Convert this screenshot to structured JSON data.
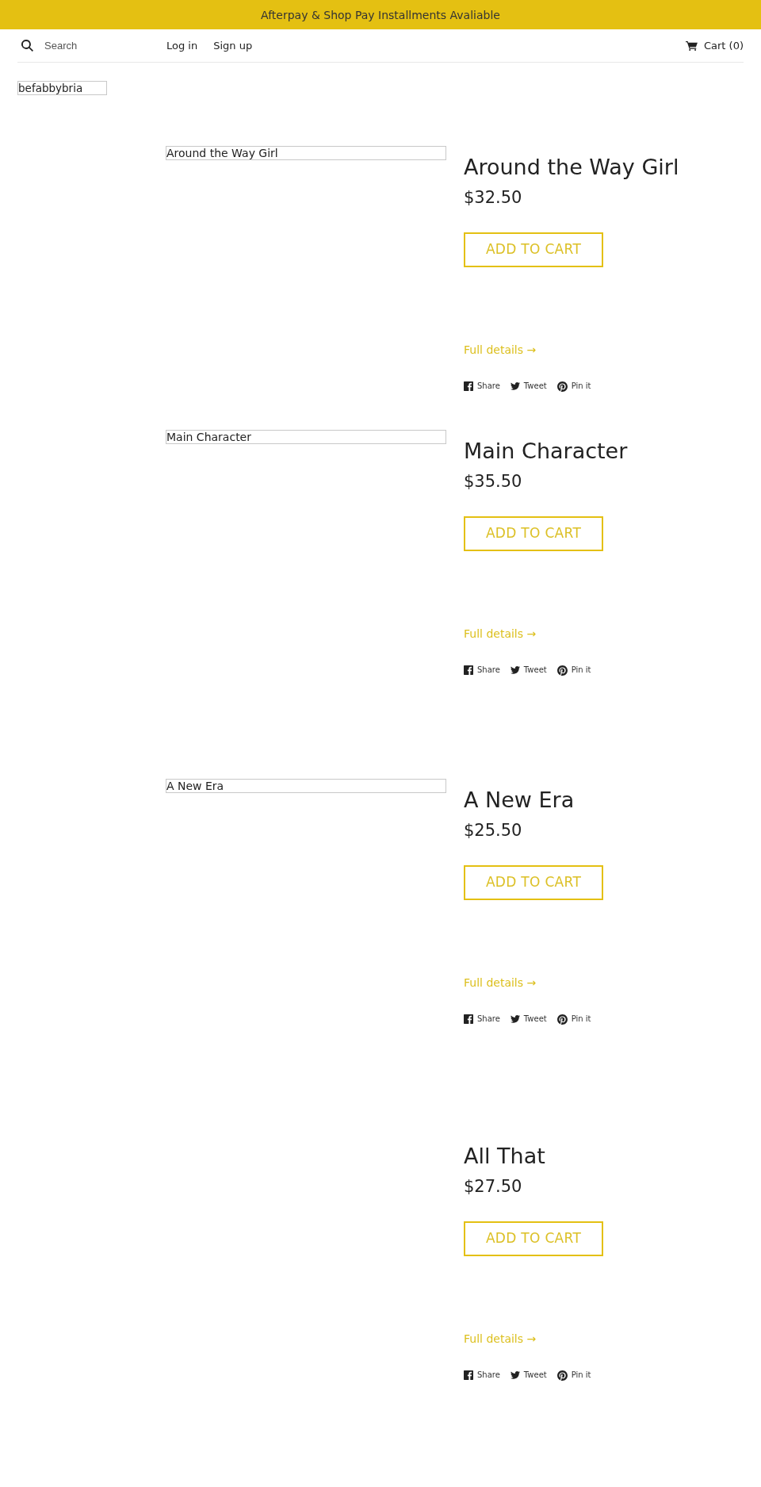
{
  "announcement": {
    "text": "Afterpay & Shop Pay Installments Avaliable"
  },
  "header": {
    "search": {
      "placeholder": "Search"
    },
    "account_links": [
      "Log in",
      "Sign up"
    ],
    "cart": {
      "label": "Cart (0)"
    }
  },
  "logo": {
    "alt_text": "befabbybria"
  },
  "products": [
    {
      "image_alt": "Around the Way Girl",
      "title": "Around the Way Girl",
      "price": "$32.50",
      "button": "ADD TO CART",
      "details_link": "Full details →",
      "share": [
        {
          "kind": "facebook",
          "label": "Share"
        },
        {
          "kind": "twitter",
          "label": "Tweet"
        },
        {
          "kind": "pinterest",
          "label": "Pin it"
        }
      ]
    },
    {
      "image_alt": "Main Character",
      "title": "Main Character",
      "price": "$35.50",
      "button": "ADD TO CART",
      "details_link": "Full details →",
      "share": [
        {
          "kind": "facebook",
          "label": "Share"
        },
        {
          "kind": "twitter",
          "label": "Tweet"
        },
        {
          "kind": "pinterest",
          "label": "Pin it"
        }
      ]
    },
    {
      "image_alt": "A New Era",
      "title": "A New Era",
      "price": "$25.50",
      "button": "ADD TO CART",
      "details_link": "Full details →",
      "share": [
        {
          "kind": "facebook",
          "label": "Share"
        },
        {
          "kind": "twitter",
          "label": "Tweet"
        },
        {
          "kind": "pinterest",
          "label": "Pin it"
        }
      ]
    },
    {
      "title": "All That",
      "price": "$27.50",
      "button": "ADD TO CART",
      "details_link": "Full details →",
      "share": [
        {
          "kind": "facebook",
          "label": "Share"
        },
        {
          "kind": "twitter",
          "label": "Tweet"
        },
        {
          "kind": "pinterest",
          "label": "Pin it"
        }
      ]
    }
  ]
}
